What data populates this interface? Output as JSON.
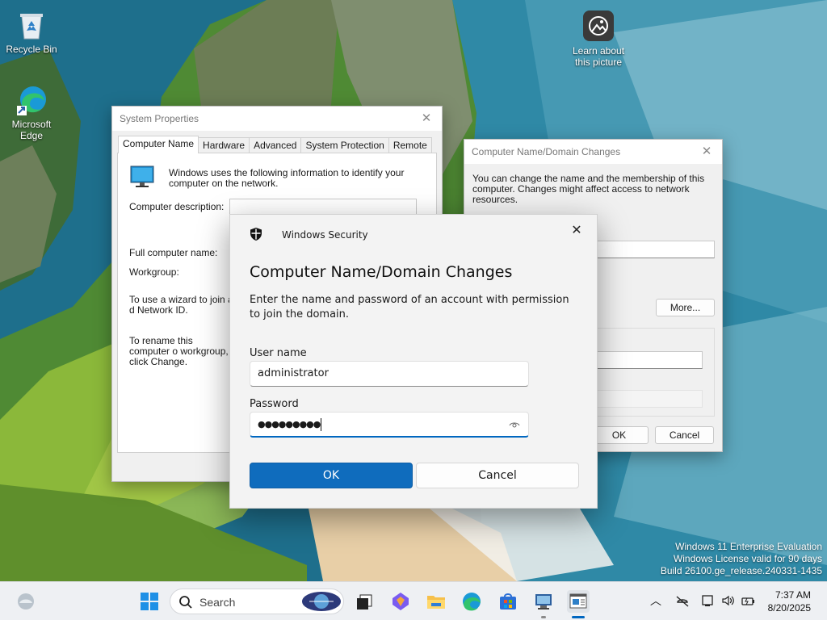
{
  "desktop": {
    "icons": [
      {
        "label": "Recycle Bin"
      },
      {
        "label": "Microsoft Edge"
      },
      {
        "label": "Learn about this picture"
      }
    ],
    "watermark": [
      "Windows 11 Enterprise Evaluation",
      "Windows License valid for 90 days",
      "Build 26100.ge_release.240331-1435"
    ]
  },
  "system_properties": {
    "title": "System Properties",
    "tabs": [
      {
        "label": "Computer Name",
        "active": true
      },
      {
        "label": "Hardware"
      },
      {
        "label": "Advanced"
      },
      {
        "label": "System Protection"
      },
      {
        "label": "Remote"
      }
    ],
    "intro": "Windows uses the following information to identify your computer on the network.",
    "description_label": "Computer description:",
    "full_name_label": "Full computer name:",
    "workgroup_label": "Workgroup:",
    "wizard_text": "To use a wizard to join a d Network ID.",
    "rename_text": "To rename this computer o workgroup, click Change."
  },
  "domain_changes": {
    "title": "Computer Name/Domain Changes",
    "intro": "You can change the name and the membership of this computer. Changes might affect access to network resources.",
    "more_button": "More...",
    "ok_button": "OK",
    "cancel_button": "Cancel"
  },
  "security_dialog": {
    "header": "Windows Security",
    "title": "Computer Name/Domain Changes",
    "description": "Enter the name and password of an account with permission to join the domain.",
    "username_label": "User name",
    "username_value": "administrator",
    "password_label": "Password",
    "password_mask": "●●●●●●●●●",
    "ok_button": "OK",
    "cancel_button": "Cancel"
  },
  "taskbar": {
    "search_placeholder": "Search",
    "apps": [
      "widgets-icon",
      "start-icon",
      "task-view-icon",
      "copilot-icon",
      "file-explorer-icon",
      "edge-icon",
      "store-icon",
      "remote-desktop-icon",
      "system-properties-icon"
    ],
    "time": "7:37 AM",
    "date": "8/20/2025"
  },
  "colors": {
    "accent": "#0f6cbd",
    "taskbar": "#eef0f3"
  }
}
